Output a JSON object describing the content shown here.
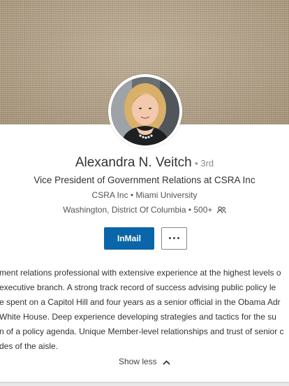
{
  "profile": {
    "name": "Alexandra N. Veitch",
    "degree": "3rd",
    "headline": "Vice President of Government Relations at CSRA Inc",
    "company_line": "CSRA Inc • Miami University",
    "location_line": "Washington, District Of Columbia • 500+",
    "avatar_icon": "profile-photo"
  },
  "actions": {
    "inmail_label": "InMail",
    "more_icon": "ellipsis-icon"
  },
  "summary": {
    "lines": [
      "ment relations professional with extensive experience at the highest levels o",
      "executive branch. A strong track record of success advising public policy le",
      "e spent on a Capitol Hill and four years as a senior official in the Obama Adr",
      " White House. Deep experience developing strategies and tactics for the su",
      "n of a policy agenda. Unique Member-level relationships and trust of senior c",
      "des of the aisle."
    ],
    "toggle_label": "Show less"
  },
  "colors": {
    "accent": "#0a66a8",
    "banner": "#b7a383"
  }
}
